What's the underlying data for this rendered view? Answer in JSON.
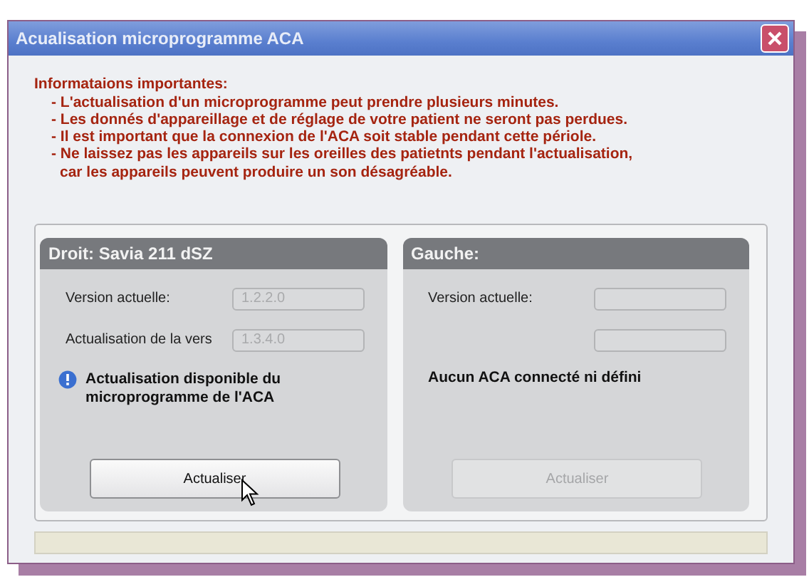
{
  "window": {
    "title": "Acualisation microprogramme ACA"
  },
  "notice": {
    "heading": "Informataions importantes:",
    "lines": [
      {
        "kind": "item",
        "text": "- L'actualisation d'un microprogramme peut prendre plusieurs minutes."
      },
      {
        "kind": "item",
        "text": "- Les donnés d'appareillage et de réglage de votre patient ne seront pas perdues."
      },
      {
        "kind": "item",
        "text": "- Il est important que la connexion de l'ACA soit stable pendant cette périole."
      },
      {
        "kind": "item",
        "text": "- Ne laissez pas les appareils sur les oreilles des patietnts pendant l'actualisation,"
      },
      {
        "kind": "continuation",
        "text": "car les appareils peuvent produire un son désagréable."
      }
    ]
  },
  "panels": [
    {
      "title": "Droit:  Savia 211 dSZ",
      "fields": [
        {
          "label": "Version actuelle:",
          "value": "1.2.2.0"
        },
        {
          "label": "Actualisation de la vers",
          "value": "1.3.4.0"
        }
      ],
      "message": {
        "kind": "info",
        "text": "Actualisation disponible du microprogramme de l'ACA"
      },
      "button": {
        "label": "Actualiser",
        "disabled": false,
        "hovered": true
      }
    },
    {
      "title": "Gauche:",
      "fields": [
        {
          "kind": "labeled",
          "label": "Version actuelle:"
        },
        {
          "kind": "blank"
        }
      ],
      "message": {
        "kind": "plain",
        "text": "Aucun ACA connecté ni défini"
      },
      "button": {
        "label": "Actualiser",
        "disabled": true,
        "hovered": false
      }
    }
  ]
}
